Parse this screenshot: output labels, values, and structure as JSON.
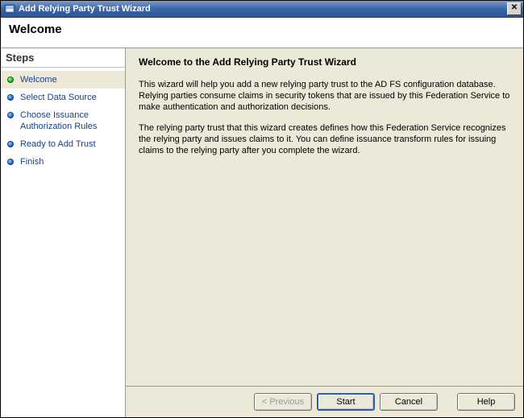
{
  "titlebar": {
    "title": "Add Relying Party Trust Wizard"
  },
  "header": {
    "title": "Welcome"
  },
  "sidebar": {
    "header": "Steps",
    "items": [
      {
        "label": "Welcome",
        "state": "current"
      },
      {
        "label": "Select Data Source",
        "state": "pending"
      },
      {
        "label": "Choose Issuance Authorization Rules",
        "state": "pending"
      },
      {
        "label": "Ready to Add Trust",
        "state": "pending"
      },
      {
        "label": "Finish",
        "state": "pending"
      }
    ]
  },
  "content": {
    "heading": "Welcome to the Add Relying Party Trust Wizard",
    "para1": "This wizard will help you add a new relying party trust to the AD FS configuration database.  Relying parties consume claims in security tokens that are issued by this Federation Service to make authentication and authorization decisions.",
    "para2": "The relying party trust that this wizard creates defines how this Federation Service recognizes the relying party and issues claims to it. You can define issuance transform rules for issuing claims to the relying party after you complete the wizard."
  },
  "buttons": {
    "previous": "< Previous",
    "start": "Start",
    "cancel": "Cancel",
    "help": "Help"
  }
}
